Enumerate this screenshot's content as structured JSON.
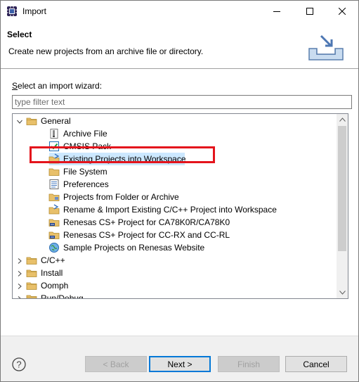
{
  "window": {
    "title": "Import",
    "app_icon": "eclipse-app-icon",
    "controls": [
      "minimize",
      "maximize",
      "close"
    ]
  },
  "banner": {
    "title": "Select",
    "description": "Create new projects from an archive file or directory.",
    "icon": "import-wizard-banner-icon"
  },
  "main": {
    "wizard_label": "Select an import wizard:",
    "wizard_label_mnemonic": "S",
    "wizard_label_rest": "elect an import wizard:",
    "filter": {
      "value": "",
      "placeholder": "type filter text"
    }
  },
  "tree": {
    "items": [
      {
        "label": "General",
        "icon": "folder-icon",
        "expanded": true,
        "level": 0
      },
      {
        "label": "Archive File",
        "icon": "archive-file-icon",
        "level": 1
      },
      {
        "label": "CMSIS Pack",
        "icon": "cmsis-pack-icon",
        "level": 1
      },
      {
        "label": "Existing Projects into Workspace",
        "icon": "existing-projects-icon",
        "level": 1,
        "selected": true,
        "highlighted": true
      },
      {
        "label": "File System",
        "icon": "file-system-folder-icon",
        "level": 1
      },
      {
        "label": "Preferences",
        "icon": "preferences-icon",
        "level": 1
      },
      {
        "label": "Projects from Folder or Archive",
        "icon": "projects-folder-icon",
        "level": 1
      },
      {
        "label": "Rename & Import Existing C/C++ Project into Workspace",
        "icon": "rename-import-icon",
        "level": 1
      },
      {
        "label": "Renesas CS+ Project for CA78K0R/CA78K0",
        "icon": "renesas-project-icon",
        "level": 1
      },
      {
        "label": "Renesas CS+ Project for CC-RX and CC-RL",
        "icon": "renesas-project-icon",
        "level": 1
      },
      {
        "label": "Sample Projects on Renesas Website",
        "icon": "globe-icon",
        "level": 1
      },
      {
        "label": "C/C++",
        "icon": "folder-icon",
        "expanded": false,
        "level": 0
      },
      {
        "label": "Install",
        "icon": "folder-icon",
        "expanded": false,
        "level": 0
      },
      {
        "label": "Oomph",
        "icon": "folder-icon",
        "expanded": false,
        "level": 0
      },
      {
        "label": "Run/Debug",
        "icon": "folder-icon",
        "expanded": false,
        "level": 0
      }
    ]
  },
  "footer": {
    "help_icon": "help-icon",
    "back": {
      "label": "< Back",
      "enabled": false
    },
    "next": {
      "label": "Next >",
      "enabled": true,
      "default": true
    },
    "finish": {
      "label": "Finish",
      "enabled": false
    },
    "cancel": {
      "label": "Cancel",
      "enabled": true
    }
  },
  "colors": {
    "selection": "#cce8ff",
    "highlight_box": "#e4141c",
    "default_button_border": "#0078d7",
    "folder": "#dcb05a"
  }
}
